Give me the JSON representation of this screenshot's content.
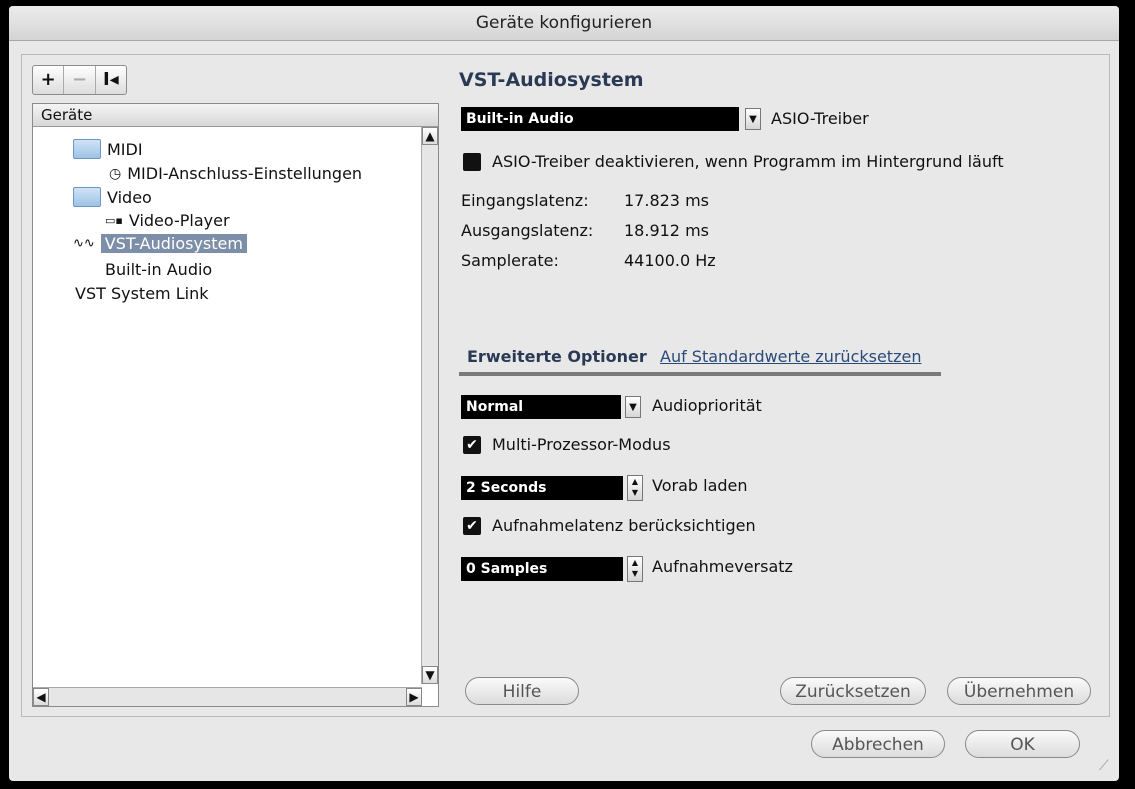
{
  "window": {
    "title": "Geräte konfigurieren"
  },
  "toolbar": {
    "add": "+",
    "remove": "−",
    "reset": "I◂"
  },
  "tree": {
    "header": "Geräte",
    "items": [
      {
        "label": "MIDI"
      },
      {
        "label": "MIDI-Anschluss-Einstellungen"
      },
      {
        "label": "Video"
      },
      {
        "label": "Video-Player"
      },
      {
        "label": "VST-Audiosystem"
      },
      {
        "label": "Built-in Audio"
      },
      {
        "label": "VST System Link"
      }
    ]
  },
  "main": {
    "title": "VST-Audiosystem",
    "driver": {
      "value": "Built-in Audio",
      "label": "ASIO-Treiber"
    },
    "deactivate_label": "ASIO-Treiber deaktivieren, wenn Programm im Hintergrund läuft",
    "info": [
      {
        "label": "Eingangslatenz:",
        "value": "17.823 ms"
      },
      {
        "label": "Ausgangslatenz:",
        "value": "18.912 ms"
      },
      {
        "label": "Samplerate:",
        "value": "44100.0 Hz"
      }
    ],
    "tab_label": "Erweiterte Optioner",
    "reset_link": "Auf Standardwerte zurücksetzen",
    "priority": {
      "value": "Normal",
      "label": "Audiopriorität"
    },
    "multiproc": {
      "label": "Multi-Prozessor-Modus",
      "checked": true
    },
    "preload": {
      "value": "2 Seconds",
      "label": "Vorab laden"
    },
    "rec_latency": {
      "label": "Aufnahmelatenz berücksichtigen",
      "checked": true
    },
    "rec_offset": {
      "value": "0 Samples",
      "label": "Aufnahmeversatz"
    }
  },
  "buttons": {
    "help": "Hilfe",
    "reset": "Zurücksetzen",
    "apply": "Übernehmen",
    "cancel": "Abbrechen",
    "ok": "OK"
  }
}
